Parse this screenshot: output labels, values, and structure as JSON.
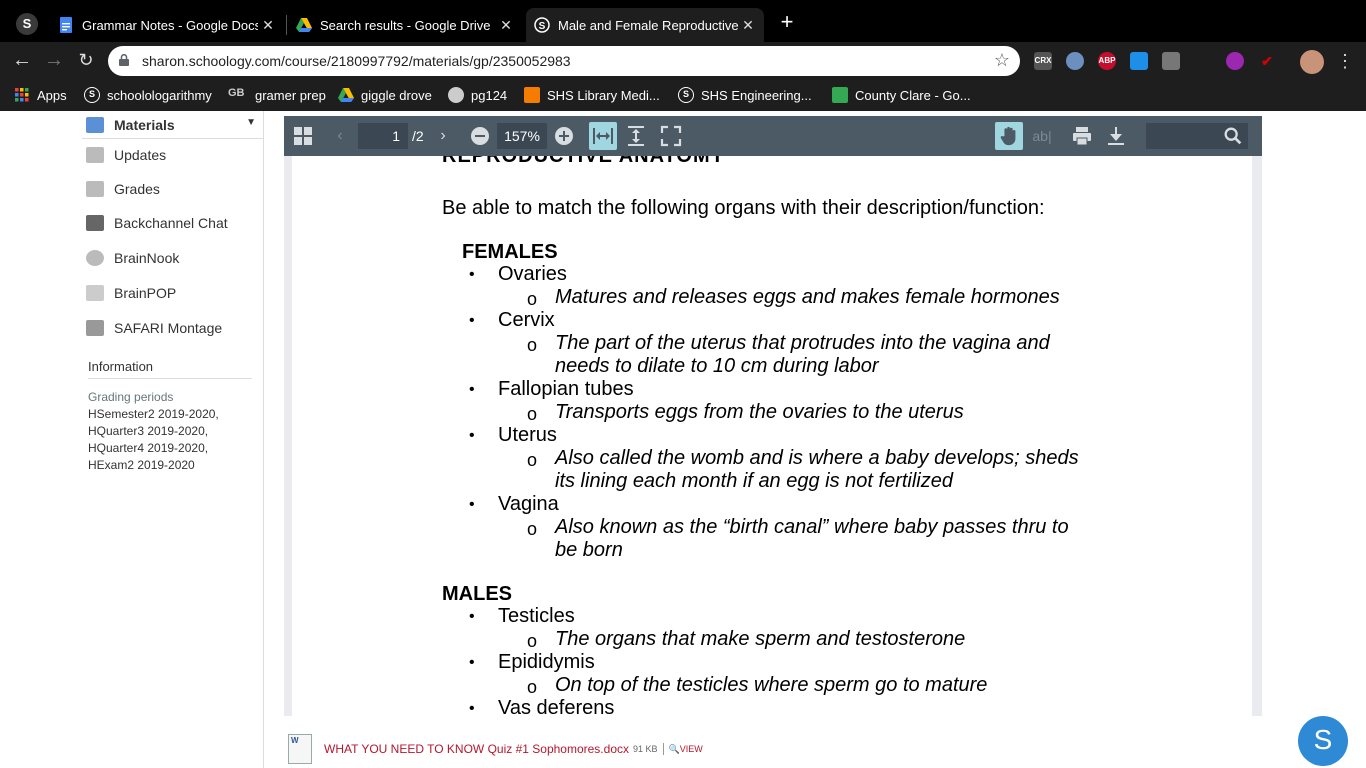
{
  "browser": {
    "tabs": [
      {
        "title": "Grammar Notes - Google Docs",
        "icon": "google-docs-icon",
        "close": "✕"
      },
      {
        "title": "Search results - Google Drive",
        "icon": "google-drive-icon",
        "close": "✕"
      },
      {
        "title": "Male and Female Reproductive",
        "icon": "schoology-icon",
        "close": "✕"
      }
    ],
    "new_tab": "+",
    "url": "sharon.schoology.com/course/2180997792/materials/gp/2350052983",
    "star": "☆",
    "extensions": [
      {
        "name": "crx-icon",
        "label": "CRX",
        "color": "#555555"
      },
      {
        "name": "owl-icon",
        "label": "",
        "color": "#6b8fbf"
      },
      {
        "name": "adblock-plus-icon",
        "label": "ABP",
        "color": "#c70d2c"
      },
      {
        "name": "checkmark-icon",
        "label": "",
        "color": "#1d8fe8"
      },
      {
        "name": "briefcase-icon",
        "label": "",
        "color": "#777777"
      },
      {
        "name": "apps-dark-icon",
        "label": "",
        "color": "#1e1e1e"
      },
      {
        "name": "color-picker-icon",
        "label": "",
        "color": "#9c27b0"
      },
      {
        "name": "check-red-icon",
        "label": "",
        "color": "#d50000"
      }
    ],
    "bookmarks": [
      {
        "label": "Apps",
        "icon": "apps-grid-icon",
        "color": "#e53935"
      },
      {
        "label": "schoolologarithmy",
        "icon": "schoology-icon",
        "color": "#1e1e1e"
      },
      {
        "label": "gramer prep",
        "icon": "gb-icon",
        "color": "#333333"
      },
      {
        "label": "giggle drove",
        "icon": "google-drive-icon",
        "color": "#f4b400"
      },
      {
        "label": "pg124",
        "icon": "globe-icon",
        "color": "#cccccc"
      },
      {
        "label": "SHS Library Medi...",
        "icon": "library-icon",
        "color": "#f57c00"
      },
      {
        "label": "SHS Engineering...",
        "icon": "schoology-icon",
        "color": "#1e1e1e"
      },
      {
        "label": "County Clare - Go...",
        "icon": "google-maps-icon",
        "color": "#34a853"
      }
    ]
  },
  "sidebar": {
    "items": [
      {
        "label": "Materials",
        "icon": "materials-icon"
      },
      {
        "label": "Updates",
        "icon": "updates-icon"
      },
      {
        "label": "Grades",
        "icon": "grades-icon"
      },
      {
        "label": "Backchannel Chat",
        "icon": "chat-icon"
      },
      {
        "label": "BrainNook",
        "icon": "brainnook-icon"
      },
      {
        "label": "BrainPOP",
        "icon": "brainpop-icon"
      },
      {
        "label": "SAFARI Montage",
        "icon": "safari-montage-icon"
      }
    ],
    "info_heading": "Information",
    "grading_label": "Grading periods",
    "grading_periods": [
      "HSemester2 2019-2020,",
      "HQuarter3 2019-2020,",
      "HQuarter4 2019-2020,",
      "HExam2 2019-2020"
    ]
  },
  "pdf_viewer": {
    "page_current": "1",
    "page_total": "/2",
    "zoom": "157%"
  },
  "document": {
    "cut_heading": "REPRODUCTIVE ANATOMY",
    "intro": "Be able to match the following organs with their description/function:",
    "sections": [
      {
        "title": "FEMALES",
        "organs": [
          {
            "name": "Ovaries",
            "desc": [
              "Matures and releases eggs and makes female hormones"
            ]
          },
          {
            "name": "Cervix",
            "desc": [
              "The part of the uterus that protrudes into the vagina and",
              "needs to dilate to 10 cm during labor"
            ]
          },
          {
            "name": "Fallopian tubes",
            "desc": [
              "Transports eggs from the ovaries to the uterus"
            ]
          },
          {
            "name": "Uterus",
            "desc": [
              "Also called the womb and is where a baby develops; sheds",
              "its lining each month if an egg is not fertilized"
            ]
          },
          {
            "name": "Vagina",
            "desc": [
              "Also known as the “birth canal” where baby passes thru to",
              "be born"
            ]
          }
        ]
      },
      {
        "title": "MALES",
        "organs": [
          {
            "name": "Testicles",
            "desc": [
              "The organs that make sperm and testosterone"
            ]
          },
          {
            "name": "Epididymis",
            "desc": [
              "On top of the testicles where sperm go to mature"
            ]
          },
          {
            "name": "Vas deferens",
            "desc": []
          }
        ]
      }
    ],
    "bullet": "•",
    "sub_bullet": "o"
  },
  "attachment": {
    "filename": "WHAT YOU NEED TO KNOW Quiz #1 Sophomores.docx",
    "size": "91 KB",
    "view": "VIEW"
  },
  "fab_label": "S"
}
